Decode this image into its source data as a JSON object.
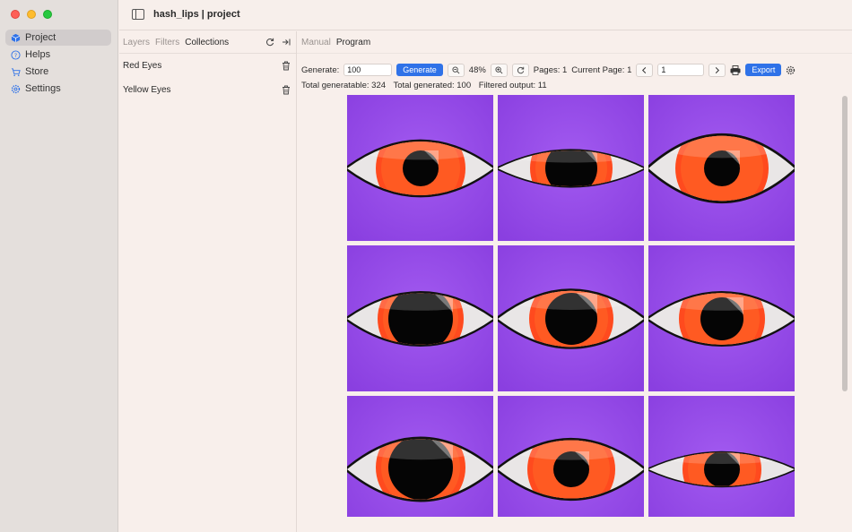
{
  "window": {
    "title": "hash_lips | project"
  },
  "sidebar": {
    "items": [
      {
        "label": "Project",
        "icon": "cube-icon",
        "active": true
      },
      {
        "label": "Helps",
        "icon": "help-icon",
        "active": false
      },
      {
        "label": "Store",
        "icon": "cart-icon",
        "active": false
      },
      {
        "label": "Settings",
        "icon": "gear-icon",
        "active": false
      }
    ]
  },
  "panel": {
    "tabs": [
      "Layers",
      "Filters",
      "Collections"
    ],
    "active_tab": "Collections",
    "collections": [
      {
        "name": "Red Eyes"
      },
      {
        "name": "Yellow Eyes"
      }
    ]
  },
  "main": {
    "tabs": [
      "Manual",
      "Program"
    ],
    "active_tab": "Program",
    "toolbar": {
      "generate_label": "Generate:",
      "generate_value": "100",
      "generate_button": "Generate",
      "zoom": "48%",
      "pages_label": "Pages: 1",
      "current_page_label": "Current Page: 1",
      "page_input": "1",
      "export_button": "Export"
    },
    "stats": {
      "total_generatable": "Total generatable: 324",
      "total_generated": "Total generated: 100",
      "filtered_output": "Filtered output: 11"
    },
    "colors": {
      "accent": "#2f72e8",
      "tile_background": "#8a3fe0",
      "iris": "#ff4a1e"
    }
  }
}
